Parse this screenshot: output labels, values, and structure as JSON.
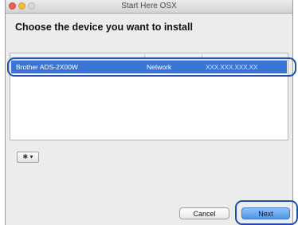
{
  "window": {
    "title": "Start Here OSX"
  },
  "heading": "Choose the device you want to install",
  "device_list": {
    "rows": [
      {
        "name": "Brother ADS-2X00W",
        "connection": "Network",
        "address": "XXX.XXX.XXX.XX"
      }
    ]
  },
  "action_menu": {
    "icon": "gear-icon",
    "label": "✱ ▾"
  },
  "buttons": {
    "cancel": "Cancel",
    "next": "Next"
  },
  "colors": {
    "selection": "#3875d7",
    "callout_outline": "#1f4fa8",
    "default_button": "#4e95e8"
  }
}
